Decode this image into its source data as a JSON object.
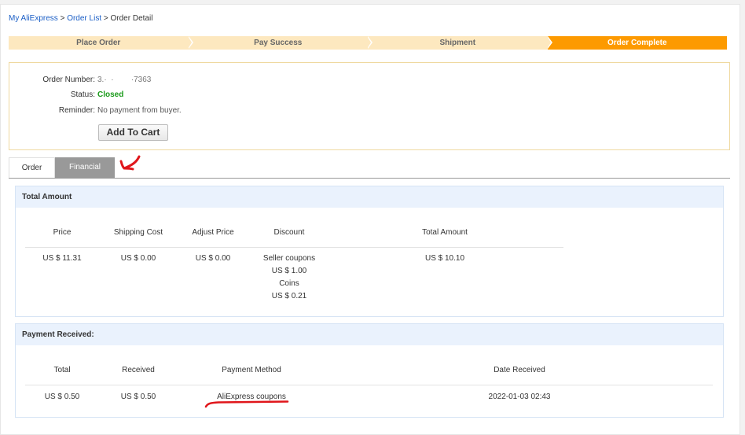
{
  "breadcrumb": {
    "items": [
      "My AliExpress",
      "Order List"
    ],
    "current": "Order Detail",
    "separator": ">"
  },
  "steps": [
    {
      "label": "Place Order",
      "active": false
    },
    {
      "label": "Pay Success",
      "active": false
    },
    {
      "label": "Shipment",
      "active": false
    },
    {
      "label": "Order Complete",
      "active": true
    }
  ],
  "order": {
    "number_label": "Order Number:",
    "number_value": "3.·  ·        ·7363",
    "status_label": "Status:",
    "status_value": "Closed",
    "reminder_label": "Reminder:",
    "reminder_value": "No payment from buyer.",
    "add_to_cart": "Add To Cart"
  },
  "tabs": [
    {
      "label": "Order",
      "active": false
    },
    {
      "label": "Financial",
      "active": true
    }
  ],
  "total_amount": {
    "title": "Total Amount",
    "headers": [
      "Price",
      "Shipping Cost",
      "Adjust Price",
      "Discount",
      "Total Amount"
    ],
    "row": {
      "price": "US $ 11.31",
      "shipping": "US $ 0.00",
      "adjust": "US $ 0.00",
      "discount": [
        "Seller coupons",
        "US $ 1.00",
        "Coins",
        "US $ 0.21"
      ],
      "total": "US $ 10.10"
    }
  },
  "payment_received": {
    "title": "Payment Received:",
    "headers": [
      "Total",
      "Received",
      "Payment Method",
      "Date Received"
    ],
    "row": {
      "total": "US $ 0.50",
      "received": "US $ 0.50",
      "method": "AliExpress coupons",
      "date": "2022-01-03 02:43"
    }
  },
  "colors": {
    "step_active": "#fd9a00",
    "step_inactive": "#fde8bf",
    "status_closed": "#1a9a1a",
    "link": "#1a5ec6",
    "annotation": "#e0161b"
  }
}
